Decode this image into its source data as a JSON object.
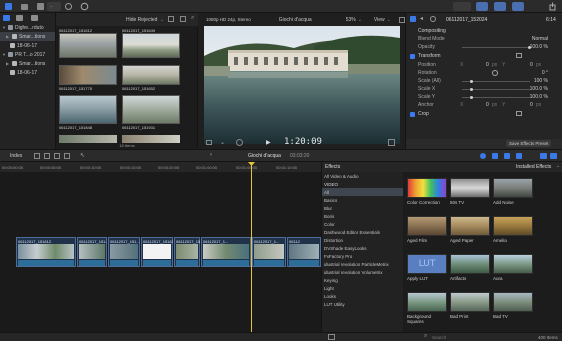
{
  "toolbar": {
    "import_label": "...",
    "tabs": [
      "library",
      "photos",
      "titles"
    ]
  },
  "sidebar": {
    "items": [
      {
        "label": "Dighe...rduto",
        "type": "library",
        "selected": false
      },
      {
        "label": "Smar...tions",
        "type": "smart",
        "selected": true
      },
      {
        "label": "18-06-17",
        "type": "event",
        "selected": false
      },
      {
        "label": "PR T...o 2017",
        "type": "library",
        "selected": false
      },
      {
        "label": "Smar...tions",
        "type": "smart",
        "selected": false
      },
      {
        "label": "18-06-17",
        "type": "event",
        "selected": false
      }
    ]
  },
  "browser": {
    "filter_label": "Hide Rejected",
    "items_count": "18 Items",
    "clips": [
      {
        "name": "06112017_151612"
      },
      {
        "name": "06112017_151649"
      },
      {
        "name": "06112017_151775"
      },
      {
        "name": "06112017_151652"
      },
      {
        "name": "06112017_151848"
      },
      {
        "name": "06112017_151931"
      }
    ]
  },
  "viewer": {
    "format": "1080p HD 24p, Stereo",
    "project": "Giochi d'acqua",
    "zoom": "53%",
    "view_label": "View",
    "timecode": "1:20:09"
  },
  "inspector": {
    "clip_name": "06112017_152024",
    "duration": "6:14",
    "sections": {
      "compositing": "Compositing",
      "transform": "Transform",
      "crop": "Crop"
    },
    "compositing_rows": [
      {
        "label": "Blend Mode",
        "value": "Normal"
      },
      {
        "label": "Opacity",
        "value": "100.0 %"
      }
    ],
    "transform_rows": [
      {
        "label": "Position",
        "x": "0",
        "y": "0",
        "unit": "px"
      },
      {
        "label": "Rotation",
        "value": "0 °"
      },
      {
        "label": "Scale (All)",
        "value": "100 %"
      },
      {
        "label": "Scale X",
        "value": "100.0 %"
      },
      {
        "label": "Scale Y",
        "value": "100.0 %"
      },
      {
        "label": "Anchor",
        "x": "0",
        "y": "0",
        "unit": "px"
      }
    ],
    "save_button": "Save Effects Preset"
  },
  "timeline": {
    "index_label": "Index",
    "project": "Giochi d'acqua",
    "duration": "03:03:20",
    "ruler": [
      "00:00:00:00",
      "00:00:05:00",
      "00:00:10:00",
      "00:00:15:00",
      "00:00:20:00",
      "00:01:00:00",
      "00:01:05:00",
      "00:01:10:00",
      "00:01:15:00"
    ],
    "clips": [
      {
        "name": "06112017_151612"
      },
      {
        "name": "06112017_151..."
      },
      {
        "name": "06112017_151..."
      },
      {
        "name": "06112017_151631"
      },
      {
        "name": "06112017_1519"
      },
      {
        "name": "06112017_1..."
      },
      {
        "name": "06112017_1..."
      },
      {
        "name": "06112"
      }
    ]
  },
  "effects": {
    "header": "Effects",
    "installed_label": "Installed Effects",
    "categories": [
      {
        "label": "All Video & Audio",
        "header": false
      },
      {
        "label": "VIDEO",
        "header": true
      },
      {
        "label": "All",
        "header": false,
        "selected": true
      },
      {
        "label": "Basics",
        "header": false
      },
      {
        "label": "Blur",
        "header": false
      },
      {
        "label": "Boris",
        "header": false
      },
      {
        "label": "Color",
        "header": false
      },
      {
        "label": "Dashwood Editor Essentials",
        "header": false
      },
      {
        "label": "Distortion",
        "header": false
      },
      {
        "label": "DVShade EasyLooks",
        "header": false
      },
      {
        "label": "FxFactory Pro",
        "header": false
      },
      {
        "label": "idustrial revolution ParticleMetrix",
        "header": false
      },
      {
        "label": "idustrial revolution Volumetrix",
        "header": false
      },
      {
        "label": "Keying",
        "header": false
      },
      {
        "label": "Light",
        "header": false
      },
      {
        "label": "Looks",
        "header": false
      },
      {
        "label": "LUT Utility",
        "header": false
      }
    ],
    "items": [
      {
        "label": "Color Correction"
      },
      {
        "label": "50s TV"
      },
      {
        "label": "Add Noise"
      },
      {
        "label": "Aged Film"
      },
      {
        "label": "Aged Paper"
      },
      {
        "label": "Amelia"
      },
      {
        "label": "Apply LUT"
      },
      {
        "label": "Artifacts"
      },
      {
        "label": "Aura"
      },
      {
        "label": "Background Squares"
      },
      {
        "label": "Bad Print"
      },
      {
        "label": "Bad TV"
      }
    ],
    "count": "400 Items",
    "search_placeholder": "Search"
  }
}
